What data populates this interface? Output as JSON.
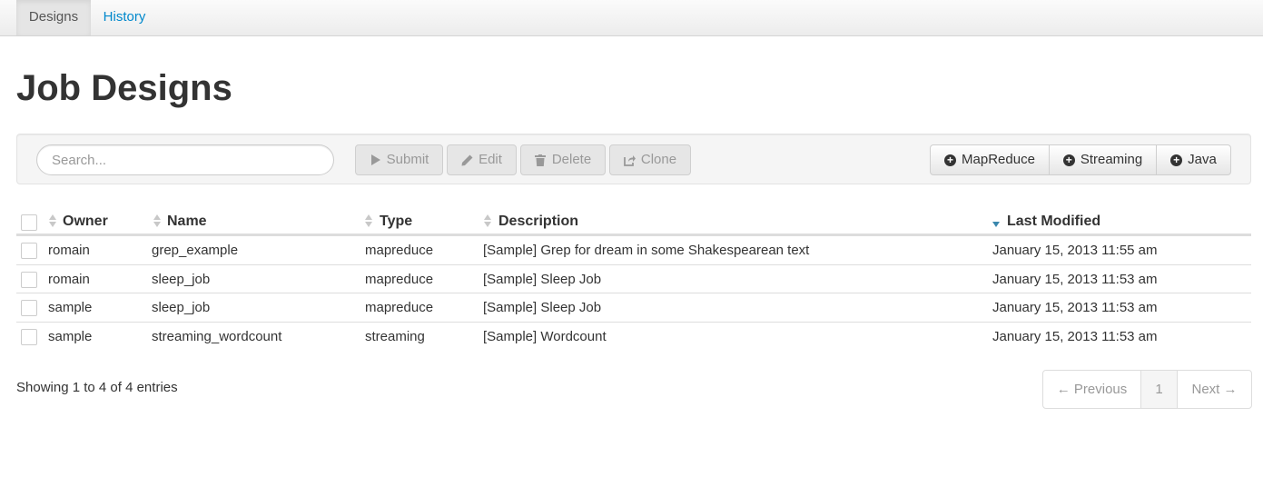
{
  "tabs": [
    {
      "label": "Designs",
      "active": true
    },
    {
      "label": "History",
      "active": false
    }
  ],
  "page_title": "Job Designs",
  "search": {
    "placeholder": "Search...",
    "value": ""
  },
  "actions": {
    "submit": "Submit",
    "edit": "Edit",
    "delete": "Delete",
    "clone": "Clone"
  },
  "create": {
    "mapreduce": "MapReduce",
    "streaming": "Streaming",
    "java": "Java"
  },
  "table": {
    "columns": {
      "owner": "Owner",
      "name": "Name",
      "type": "Type",
      "description": "Description",
      "last_modified": "Last Modified"
    },
    "sorted_column": "last_modified",
    "sort_direction": "descending",
    "rows": [
      {
        "owner": "romain",
        "name": "grep_example",
        "type": "mapreduce",
        "description": "[Sample] Grep for dream in some Shakespearean text",
        "last_modified": "January 15, 2013 11:55 am"
      },
      {
        "owner": "romain",
        "name": "sleep_job",
        "type": "mapreduce",
        "description": "[Sample] Sleep Job",
        "last_modified": "January 15, 2013 11:53 am"
      },
      {
        "owner": "sample",
        "name": "sleep_job",
        "type": "mapreduce",
        "description": "[Sample] Sleep Job",
        "last_modified": "January 15, 2013 11:53 am"
      },
      {
        "owner": "sample",
        "name": "streaming_wordcount",
        "type": "streaming",
        "description": "[Sample] Wordcount",
        "last_modified": "January 15, 2013 11:53 am"
      }
    ]
  },
  "footer": {
    "showing": "Showing 1 to 4 of 4 entries",
    "pagination": {
      "previous": "← Previous",
      "current": "1",
      "next": "Next →"
    }
  },
  "colors": {
    "link": "#0088cc",
    "sort_active": "#3a87ad"
  }
}
